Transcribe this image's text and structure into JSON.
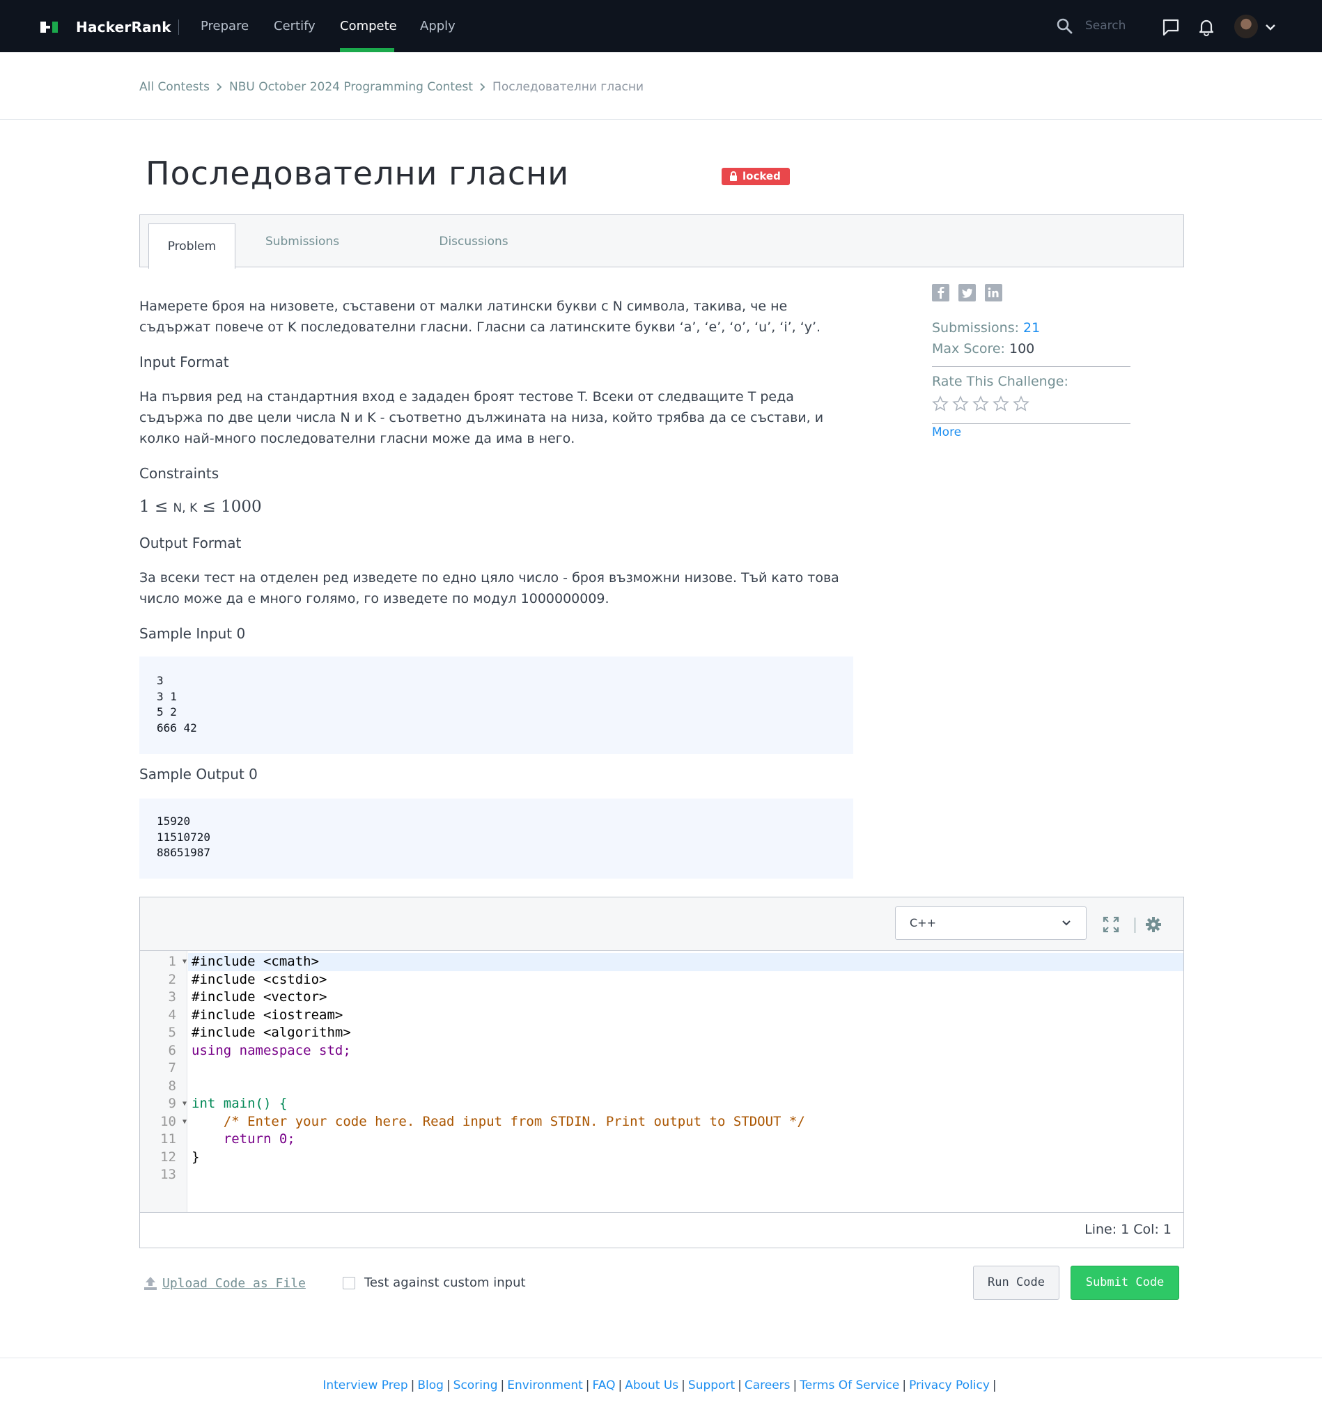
{
  "nav": {
    "brand": "HackerRank",
    "links": [
      "Prepare",
      "Certify",
      "Compete",
      "Apply"
    ],
    "active": "Compete",
    "search_placeholder": "Search"
  },
  "breadcrumb": {
    "items": [
      "All Contests",
      "NBU October 2024 Programming Contest",
      "Последователни гласни"
    ]
  },
  "title": "Последователни гласни",
  "badge": "locked",
  "tabs": [
    "Problem",
    "Submissions",
    "Discussions"
  ],
  "problem": {
    "statement": "Намерете броя на низовете, съставени от малки латински букви с N символа, такива, че не съдържат повече от K последователни гласни. Гласни са латинските букви ‘a’, ‘e’, ‘o’, ‘u’, ‘i’, ‘y’.",
    "input_format_title": "Input Format",
    "input_format": "На първия ред на стандартния вход е зададен броят тестове T. Всеки от следващите T реда съдържа по две цели числа N и K - съответно дължината на низа, който трябва да се състави, и колко най-много последователни гласни може да има в него.",
    "constraints_title": "Constraints",
    "constraints": {
      "lo": "1",
      "le1": "≤",
      "vars": "N, K",
      "le2": "≤",
      "hi": "1000"
    },
    "output_format_title": "Output Format",
    "output_format": "За всеки тест на отделен ред изведете по едно цяло число - броя възможни низове. Тъй като това число може да е много голямо, го изведете по модул 1000000009.",
    "sample_input_title": "Sample Input 0",
    "sample_input": "3\n3 1\n5 2\n666 42",
    "sample_output_title": "Sample Output 0",
    "sample_output": "15920\n11510720\n88651987"
  },
  "sidebar": {
    "submissions_label": "Submissions:",
    "submissions_value": "21",
    "max_score_label": "Max Score:",
    "max_score_value": "100",
    "rate_label": "Rate This Challenge:",
    "rating": 0,
    "more": "More",
    "share_icons": [
      "facebook-icon",
      "twitter-icon",
      "linkedin-icon"
    ]
  },
  "editor": {
    "language": "C++",
    "cursor": "Line: 1 Col: 1",
    "lines": [
      "#include <cmath>",
      "#include <cstdio>",
      "#include <vector>",
      "#include <iostream>",
      "#include <algorithm>",
      "using namespace std;",
      "",
      "",
      "int main() {",
      "    /* Enter your code here. Read input from STDIN. Print output to STDOUT */",
      "    return 0;",
      "}",
      ""
    ]
  },
  "actions": {
    "upload": "Upload Code as File",
    "custom_input": "Test against custom input",
    "run": "Run Code",
    "submit": "Submit Code"
  },
  "footer": {
    "links": [
      "Interview Prep",
      "Blog",
      "Scoring",
      "Environment",
      "FAQ",
      "About Us",
      "Support",
      "Careers",
      "Terms Of Service",
      "Privacy Policy"
    ]
  },
  "colors": {
    "nav_bg": "#0e141e",
    "accent_green": "#1ba94c",
    "submit_green": "#2ec866",
    "badge_red": "#e9474b",
    "link_blue": "#1c8ef0"
  }
}
